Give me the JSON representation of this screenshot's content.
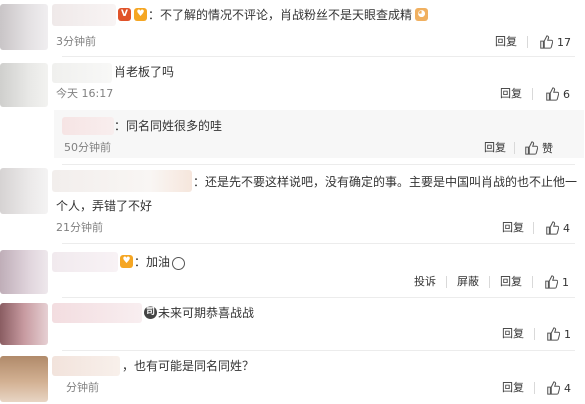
{
  "comments": [
    {
      "text": "：不了解的情况不评论，肖战粉丝不是天眼查成精",
      "time": "3分钟前",
      "reply": "回复",
      "likes": "17"
    },
    {
      "text": "肖老板了吗",
      "time": "今天 16:17",
      "reply": "回复",
      "likes": "6"
    },
    {
      "text": "：同名同姓很多的哇",
      "time": "50分钟前",
      "reply": "回复",
      "likes": "赞"
    },
    {
      "text_line1": "：还是先不要这样说吧，没有确定的事。主要是中国叫肖战的也不止他一",
      "text_line2": "个人，弄错了不好",
      "time": "21分钟前",
      "reply": "回复",
      "likes": "4"
    },
    {
      "text": "：加油",
      "report": "投诉",
      "block": "屏蔽",
      "reply": "回复",
      "likes": "1"
    },
    {
      "text": "未来可期恭喜战战",
      "reply": "回复",
      "likes": "1"
    },
    {
      "text": "，也有可能是同名同姓？",
      "time": "分钟前",
      "reply": "回复",
      "likes": "4"
    }
  ],
  "icons": {
    "vip_badge": "V",
    "badge_color": "#f5a623",
    "vip_color": "#e0532a"
  }
}
